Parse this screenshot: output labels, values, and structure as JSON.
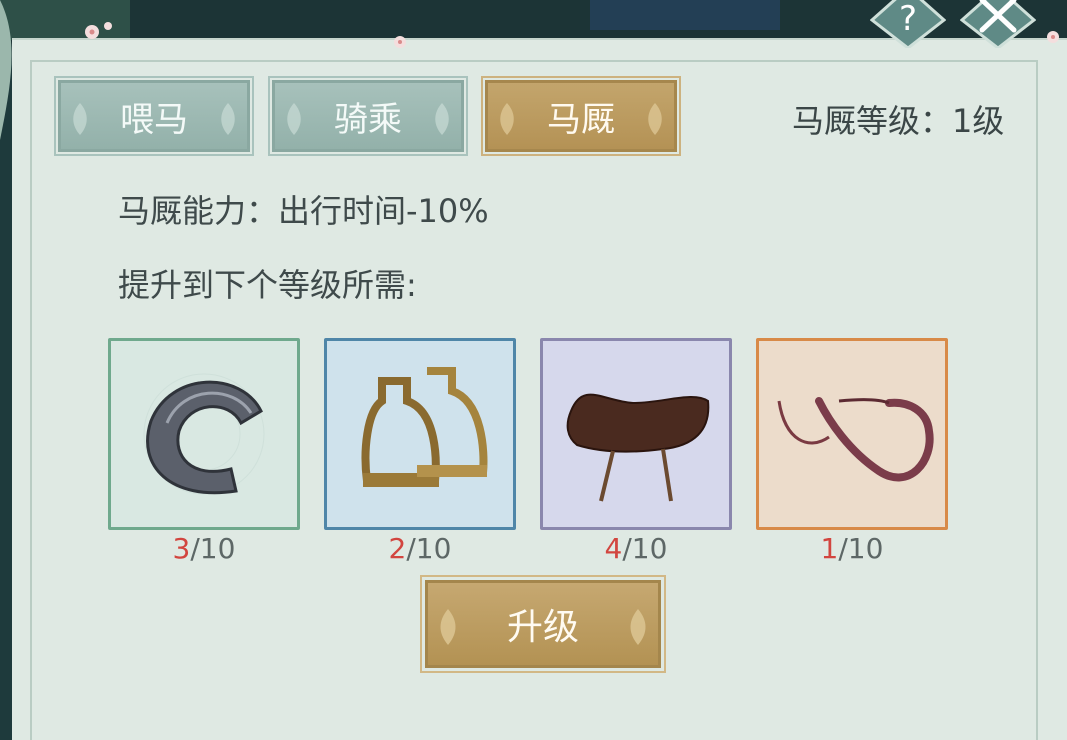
{
  "tabs": [
    {
      "label": "喂马",
      "active": false
    },
    {
      "label": "骑乘",
      "active": false
    },
    {
      "label": "马厩",
      "active": true
    }
  ],
  "stable_level": "马厩等级：1级",
  "stable_ability": "马厩能力：出行时间-10%",
  "requirement_label": "提升到下个等级所需:",
  "items": [
    {
      "icon": "horseshoe-icon",
      "have": "3",
      "need": "/10",
      "rarity_color": "#6fa98d"
    },
    {
      "icon": "stirrups-icon",
      "have": "2",
      "need": "/10",
      "rarity_color": "#4f86a8"
    },
    {
      "icon": "saddle-icon",
      "have": "4",
      "need": "/10",
      "rarity_color": "#8a87ad"
    },
    {
      "icon": "whip-icon",
      "have": "1",
      "need": "/10",
      "rarity_color": "#d88a48"
    }
  ],
  "upgrade_button": "升级",
  "colors": {
    "gold_accent": "#b8975a",
    "panel_bg": "#dfe9e3",
    "count_highlight": "#d2453f"
  }
}
